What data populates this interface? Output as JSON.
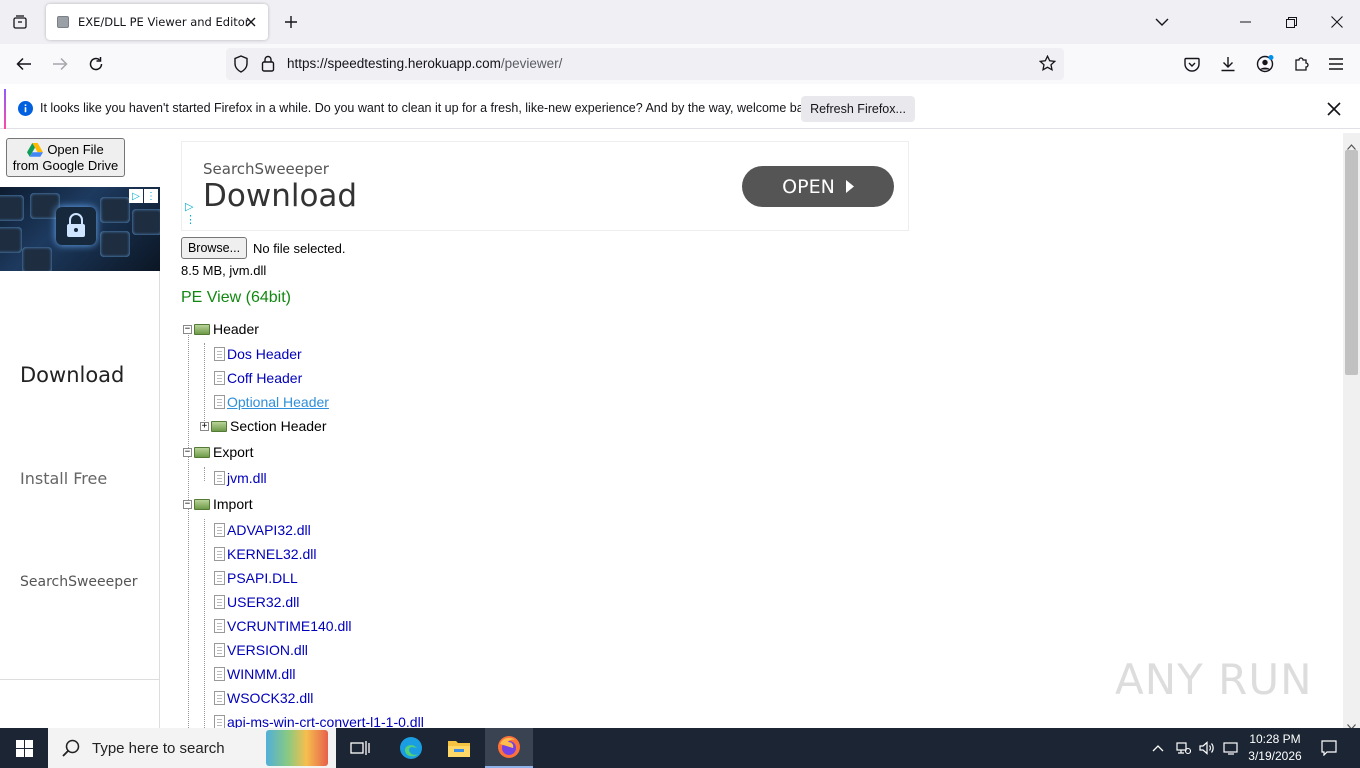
{
  "browser": {
    "tab_title": "EXE/DLL PE Viewer and Editor",
    "url_host": "https://speedtesting.herokuapp.com",
    "url_path": "/peviewer/",
    "notification_text": "It looks like you haven't started Firefox in a while. Do you want to clean it up for a fresh, like-new experience? And by the way, welcome back!",
    "notification_button": "Refresh Firefox..."
  },
  "page": {
    "gdrive_line1": "Open File",
    "gdrive_line2": "from Google Drive",
    "side_ad": {
      "word1": "Download",
      "word2": "Install Free",
      "word3": "SearchSweeeper"
    },
    "top_ad": {
      "brand": "SearchSweeeper",
      "title": "Download",
      "open_label": "OPEN"
    },
    "browse_label": "Browse...",
    "file_status": "No file selected.",
    "file_info": "8.5 MB, jvm.dll",
    "pe_view_title": "PE View (64bit)",
    "tree": {
      "header": "Header",
      "header_children": [
        "Dos Header",
        "Coff Header",
        "Optional Header"
      ],
      "section_header": "Section Header",
      "export": "Export",
      "export_children": [
        "jvm.dll"
      ],
      "import": "Import",
      "import_children": [
        "ADVAPI32.dll",
        "KERNEL32.dll",
        "PSAPI.DLL",
        "USER32.dll",
        "VCRUNTIME140.dll",
        "VERSION.dll",
        "WINMM.dll",
        "WSOCK32.dll",
        "api-ms-win-crt-convert-l1-1-0.dll"
      ]
    },
    "watermark": "ANY RUN"
  },
  "taskbar": {
    "search_placeholder": "Type here to search",
    "time": "10:28 PM",
    "date": "3/19/2026"
  }
}
